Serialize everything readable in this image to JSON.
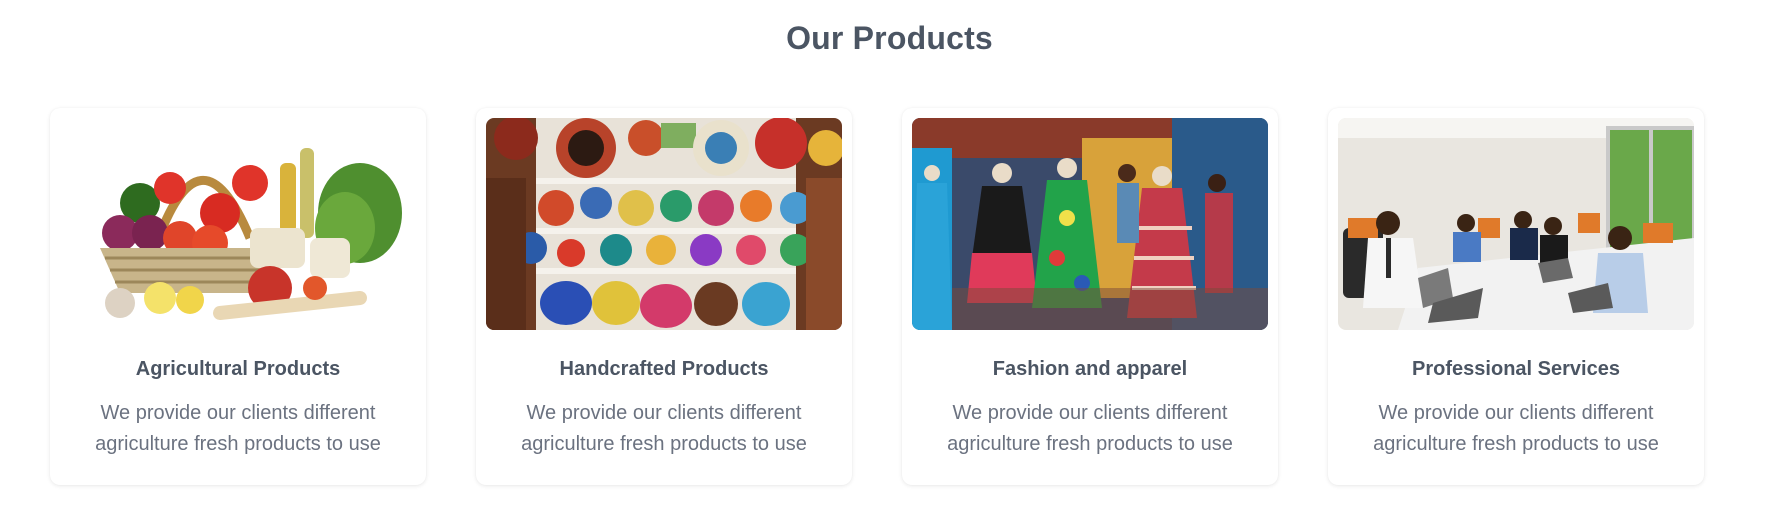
{
  "section": {
    "title": "Our Products"
  },
  "cards": [
    {
      "title": "Agricultural Products",
      "desc_line1": "We provide our clients different",
      "desc_line2": "agriculture fresh products to use",
      "image": "vegetable-basket-photo"
    },
    {
      "title": "Handcrafted Products",
      "desc_line1": "We provide our clients different",
      "desc_line2": "agriculture fresh products to use",
      "image": "woven-baskets-shelf-photo"
    },
    {
      "title": "Fashion and apparel",
      "desc_line1": "We provide our clients different",
      "desc_line2": "agriculture fresh products to use",
      "image": "african-print-dresses-photo"
    },
    {
      "title": "Professional Services",
      "desc_line1": "We provide our clients different",
      "desc_line2": "agriculture fresh products to use",
      "image": "office-meeting-photo"
    }
  ],
  "colors": {
    "heading": "#4b5563",
    "body_text": "#6b7280",
    "card_bg": "#ffffff"
  }
}
